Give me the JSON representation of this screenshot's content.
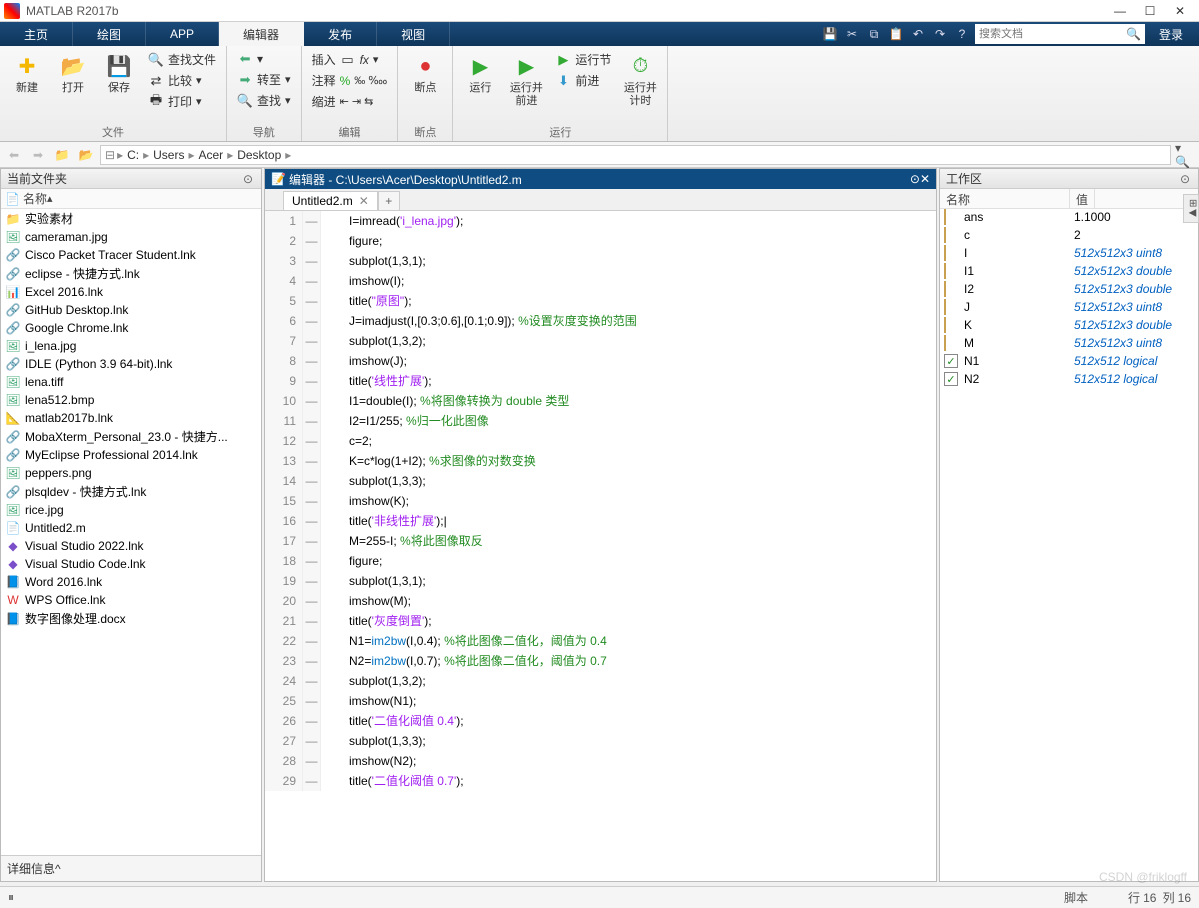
{
  "window": {
    "title": "MATLAB R2017b",
    "search_placeholder": "搜索文档",
    "login": "登录"
  },
  "tabs": {
    "home": "主页",
    "plots": "绘图",
    "apps": "APP",
    "editor": "编辑器",
    "publish": "发布",
    "view": "视图"
  },
  "ribbon": {
    "file": {
      "new": "新建",
      "open": "打开",
      "save": "保存",
      "findfiles": "查找文件",
      "compare": "比较",
      "print": "打印",
      "label": "文件"
    },
    "nav": {
      "back": "",
      "goto": "转至",
      "find": "查找",
      "label": "导航"
    },
    "edit": {
      "insert": "插入",
      "comment": "注释",
      "indent": "缩进",
      "label": "编辑"
    },
    "bp": {
      "breakpoints": "断点",
      "label": "断点"
    },
    "run": {
      "run": "运行",
      "runadvance": "运行并\n前进",
      "runsection": "运行节",
      "advance": "前进",
      "runtime": "运行并\n计时",
      "label": "运行"
    }
  },
  "breadcrumbs": [
    "C:",
    "Users",
    "Acer",
    "Desktop"
  ],
  "left": {
    "title": "当前文件夹",
    "name_hdr": "名称",
    "detail": "详细信息",
    "files": [
      {
        "n": "实验素材",
        "t": "folder"
      },
      {
        "n": "cameraman.jpg",
        "t": "img"
      },
      {
        "n": "Cisco Packet Tracer Student.lnk",
        "t": "lnk"
      },
      {
        "n": "eclipse - 快捷方式.lnk",
        "t": "lnk"
      },
      {
        "n": "Excel 2016.lnk",
        "t": "xls"
      },
      {
        "n": "GitHub Desktop.lnk",
        "t": "lnk"
      },
      {
        "n": "Google Chrome.lnk",
        "t": "lnk"
      },
      {
        "n": "i_lena.jpg",
        "t": "img"
      },
      {
        "n": "IDLE (Python 3.9 64-bit).lnk",
        "t": "lnk"
      },
      {
        "n": "lena.tiff",
        "t": "img"
      },
      {
        "n": "lena512.bmp",
        "t": "img"
      },
      {
        "n": "matlab2017b.lnk",
        "t": "ml"
      },
      {
        "n": "MobaXterm_Personal_23.0 - 快捷方...",
        "t": "lnk"
      },
      {
        "n": "MyEclipse Professional 2014.lnk",
        "t": "lnk"
      },
      {
        "n": "peppers.png",
        "t": "img"
      },
      {
        "n": "plsqldev - 快捷方式.lnk",
        "t": "lnk"
      },
      {
        "n": "rice.jpg",
        "t": "img"
      },
      {
        "n": "Untitled2.m",
        "t": "m"
      },
      {
        "n": "Visual Studio 2022.lnk",
        "t": "vs"
      },
      {
        "n": "Visual Studio Code.lnk",
        "t": "vs"
      },
      {
        "n": "Word 2016.lnk",
        "t": "doc"
      },
      {
        "n": "WPS Office.lnk",
        "t": "wps"
      },
      {
        "n": "数字图像处理.docx",
        "t": "doc"
      }
    ]
  },
  "editor": {
    "header": "编辑器 - C:\\Users\\Acer\\Desktop\\Untitled2.m",
    "tab": "Untitled2.m",
    "lines": [
      [
        [
          "tk",
          "I=imread("
        ],
        [
          "str",
          "'i_lena.jpg'"
        ],
        [
          "tk",
          ");"
        ]
      ],
      [
        [
          "tk",
          "figure;"
        ]
      ],
      [
        [
          "tk",
          "subplot(1,3,1);"
        ]
      ],
      [
        [
          "tk",
          "imshow(I);"
        ]
      ],
      [
        [
          "tk",
          "title("
        ],
        [
          "str",
          "\"原图\""
        ],
        [
          "tk",
          ");"
        ]
      ],
      [
        [
          "tk",
          "J=imadjust(I,[0.3;0.6],[0.1;0.9]); "
        ],
        [
          "com",
          "%设置灰度变换的范围"
        ]
      ],
      [
        [
          "tk",
          "subplot(1,3,2);"
        ]
      ],
      [
        [
          "tk",
          "imshow(J);"
        ]
      ],
      [
        [
          "tk",
          "title("
        ],
        [
          "str",
          "'线性扩展'"
        ],
        [
          "tk",
          ");"
        ]
      ],
      [
        [
          "tk",
          "I1=double(I); "
        ],
        [
          "com",
          "%将图像转换为 double 类型"
        ]
      ],
      [
        [
          "tk",
          "I2=I1/255; "
        ],
        [
          "com",
          "%归一化此图像"
        ]
      ],
      [
        [
          "tk",
          "c=2;"
        ]
      ],
      [
        [
          "tk",
          "K=c*log(1+I2); "
        ],
        [
          "com",
          "%求图像的对数变换"
        ]
      ],
      [
        [
          "tk",
          "subplot(1,3,3);"
        ]
      ],
      [
        [
          "tk",
          "imshow(K);"
        ]
      ],
      [
        [
          "tk",
          "title("
        ],
        [
          "str",
          "'非线性扩展'"
        ],
        [
          "tk",
          ");|"
        ]
      ],
      [
        [
          "tk",
          "M=255-I; "
        ],
        [
          "com",
          "%将此图像取反"
        ]
      ],
      [
        [
          "tk",
          "figure;"
        ]
      ],
      [
        [
          "tk",
          "subplot(1,3,1);"
        ]
      ],
      [
        [
          "tk",
          "imshow(M);"
        ]
      ],
      [
        [
          "tk",
          "title("
        ],
        [
          "str",
          "'灰度倒置'"
        ],
        [
          "tk",
          ");"
        ]
      ],
      [
        [
          "tk",
          "N1="
        ],
        [
          "fn",
          "im2bw"
        ],
        [
          "tk",
          "(I,0.4); "
        ],
        [
          "com",
          "%将此图像二值化，阈值为 0.4"
        ]
      ],
      [
        [
          "tk",
          "N2="
        ],
        [
          "fn",
          "im2bw"
        ],
        [
          "tk",
          "(I,0.7); "
        ],
        [
          "com",
          "%将此图像二值化，阈值为 0.7"
        ]
      ],
      [
        [
          "tk",
          "subplot(1,3,2);"
        ]
      ],
      [
        [
          "tk",
          "imshow(N1);"
        ]
      ],
      [
        [
          "tk",
          "title("
        ],
        [
          "str",
          "'二值化阈值 0.4'"
        ],
        [
          "tk",
          ");"
        ]
      ],
      [
        [
          "tk",
          "subplot(1,3,3);"
        ]
      ],
      [
        [
          "tk",
          "imshow(N2);"
        ]
      ],
      [
        [
          "tk",
          "title("
        ],
        [
          "str",
          "'二值化阈值 0.7'"
        ],
        [
          "tk",
          ");"
        ]
      ]
    ]
  },
  "workspace": {
    "title": "工作区",
    "name_hdr": "名称",
    "val_hdr": "值",
    "vars": [
      {
        "n": "ans",
        "v": "1.1000",
        "p": true,
        "ic": "var"
      },
      {
        "n": "c",
        "v": "2",
        "p": true,
        "ic": "var"
      },
      {
        "n": "I",
        "v": "512x512x3 uint8",
        "ic": "var"
      },
      {
        "n": "I1",
        "v": "512x512x3 double",
        "ic": "var"
      },
      {
        "n": "I2",
        "v": "512x512x3 double",
        "ic": "var"
      },
      {
        "n": "J",
        "v": "512x512x3 uint8",
        "ic": "var"
      },
      {
        "n": "K",
        "v": "512x512x3 double",
        "ic": "var"
      },
      {
        "n": "M",
        "v": "512x512x3 uint8",
        "ic": "var"
      },
      {
        "n": "N1",
        "v": "512x512 logical",
        "ic": "chk"
      },
      {
        "n": "N2",
        "v": "512x512 logical",
        "ic": "chk"
      }
    ]
  },
  "status": {
    "script": "脚本",
    "ln": "行",
    "lnv": "16",
    "col": "列",
    "colv": "16"
  },
  "watermark": "CSDN @friklogff"
}
